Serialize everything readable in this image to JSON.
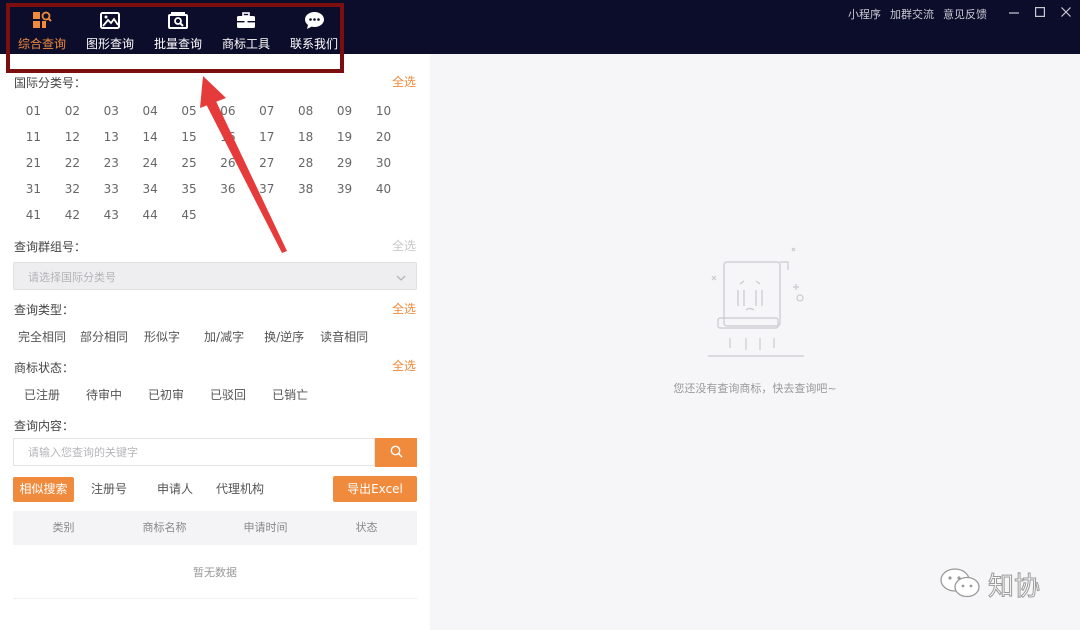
{
  "nav": {
    "items": [
      {
        "label": "综合查询",
        "icon": "grid-search-icon",
        "active": true
      },
      {
        "label": "图形查询",
        "icon": "image-icon",
        "active": false
      },
      {
        "label": "批量查询",
        "icon": "batch-search-icon",
        "active": false
      },
      {
        "label": "商标工具",
        "icon": "toolbox-icon",
        "active": false
      },
      {
        "label": "联系我们",
        "icon": "chat-bubble-icon",
        "active": false
      }
    ]
  },
  "top_links": [
    "小程序",
    "加群交流",
    "意见反馈"
  ],
  "window_controls": [
    "minimize-icon",
    "maximize-icon",
    "close-icon"
  ],
  "intl_class": {
    "title": "国际分类号：",
    "select_all": "全选",
    "numbers": [
      "01",
      "02",
      "03",
      "04",
      "05",
      "06",
      "07",
      "08",
      "09",
      "10",
      "11",
      "12",
      "13",
      "14",
      "15",
      "16",
      "17",
      "18",
      "19",
      "20",
      "21",
      "22",
      "23",
      "24",
      "25",
      "26",
      "27",
      "28",
      "29",
      "30",
      "31",
      "32",
      "33",
      "34",
      "35",
      "36",
      "37",
      "38",
      "39",
      "40",
      "41",
      "42",
      "43",
      "44",
      "45"
    ]
  },
  "group": {
    "title": "查询群组号：",
    "select_all": "全选",
    "placeholder": "请选择国际分类号"
  },
  "query_type": {
    "title": "查询类型：",
    "select_all": "全选",
    "options": [
      "完全相同",
      "部分相同",
      "形似字",
      "加/减字",
      "换/逆序",
      "读音相同"
    ]
  },
  "status": {
    "title": "商标状态：",
    "select_all": "全选",
    "options": [
      "已注册",
      "待审中",
      "已初审",
      "已驳回",
      "已销亡"
    ]
  },
  "content": {
    "title": "查询内容：",
    "placeholder": "请输入您查询的关键字"
  },
  "tabs": {
    "active": "相似搜索",
    "others": [
      "注册号",
      "申请人",
      "代理机构"
    ],
    "export": "导出Excel"
  },
  "table": {
    "headers": [
      "类别",
      "商标名称",
      "申请时间",
      "状态"
    ],
    "empty": "暂无数据"
  },
  "right_panel": {
    "empty_text": "您还没有查询商标，快去查询吧~"
  },
  "watermark": {
    "text": "知协"
  },
  "colors": {
    "accent": "#f08a3c",
    "topbar": "#0c0d2a",
    "highlight_box": "#7b0e0e",
    "arrow": "#e53b3b"
  }
}
